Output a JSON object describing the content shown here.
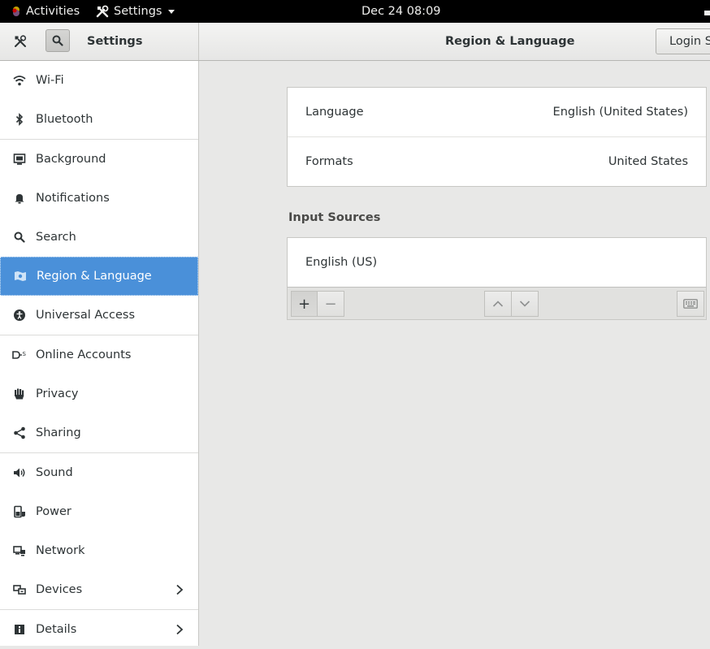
{
  "topbar": {
    "activities": "Activities",
    "app_menu": "Settings",
    "clock": "Dec 24  08:09"
  },
  "header": {
    "app_title": "Settings",
    "panel_title": "Region & Language",
    "login_button": "Login Screen"
  },
  "sidebar": {
    "items": [
      {
        "label": "Wi-Fi",
        "icon": "wifi-icon"
      },
      {
        "label": "Bluetooth",
        "icon": "bluetooth-icon"
      },
      {
        "label": "Background",
        "icon": "background-icon"
      },
      {
        "label": "Notifications",
        "icon": "bell-icon"
      },
      {
        "label": "Search",
        "icon": "search-icon"
      },
      {
        "label": "Region & Language",
        "icon": "region-icon",
        "selected": true
      },
      {
        "label": "Universal Access",
        "icon": "accessibility-icon"
      },
      {
        "label": "Online Accounts",
        "icon": "online-accounts-icon"
      },
      {
        "label": "Privacy",
        "icon": "hand-icon"
      },
      {
        "label": "Sharing",
        "icon": "share-icon"
      },
      {
        "label": "Sound",
        "icon": "speaker-icon"
      },
      {
        "label": "Power",
        "icon": "power-icon"
      },
      {
        "label": "Network",
        "icon": "network-icon"
      },
      {
        "label": "Devices",
        "icon": "devices-icon"
      },
      {
        "label": "Details",
        "icon": "info-icon"
      }
    ]
  },
  "region": {
    "language_label": "Language",
    "language_value": "English (United States)",
    "formats_label": "Formats",
    "formats_value": "United States"
  },
  "input_sources": {
    "title": "Input Sources",
    "items": [
      "English (US)"
    ],
    "add_label": "+",
    "remove_label": "−"
  },
  "colors": {
    "accent": "#4a90d9",
    "topbar": "#000000",
    "content_bg": "#e8e8e7"
  }
}
